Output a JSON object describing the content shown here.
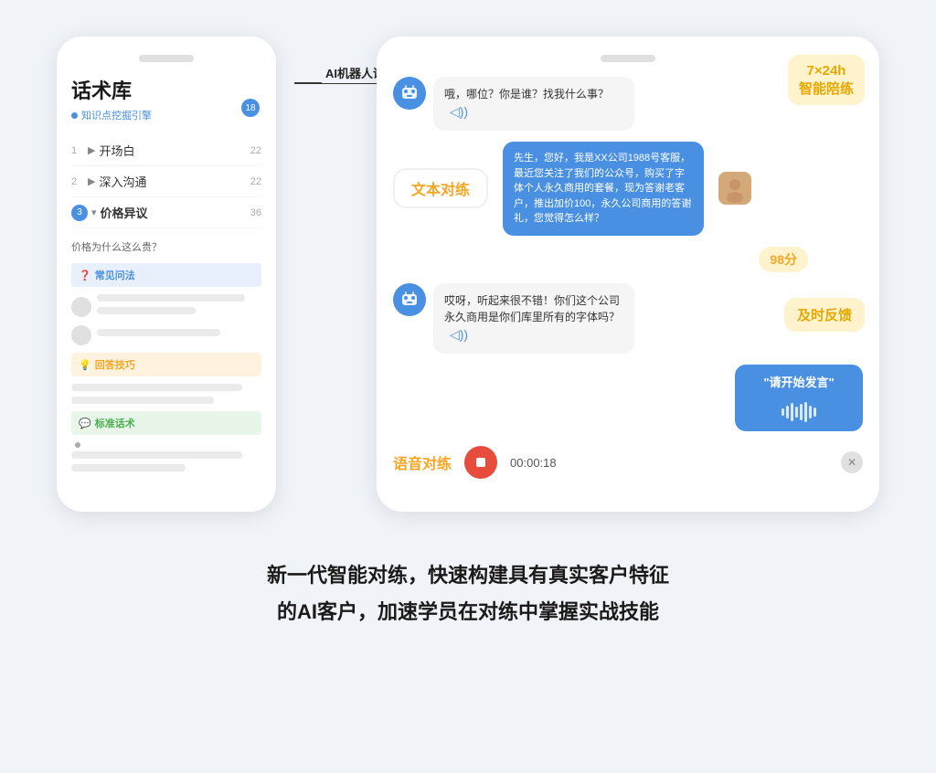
{
  "left_phone": {
    "notch": "",
    "title": "话术库",
    "subtitle": "知识点挖掘引擎",
    "badge": "18",
    "menu": [
      {
        "num": "1",
        "label": "开场白",
        "count": "22",
        "active": false
      },
      {
        "num": "2",
        "label": "深入沟通",
        "count": "22",
        "active": false
      },
      {
        "num": "3",
        "label": "价格异议",
        "count": "36",
        "active": true
      }
    ],
    "question": "价格为什么这么贵？",
    "sections": [
      {
        "type": "blue",
        "icon": "❓",
        "label": "常见问法"
      },
      {
        "type": "orange",
        "icon": "💡",
        "label": "回答技巧"
      },
      {
        "type": "green",
        "icon": "💬",
        "label": "标准话术"
      }
    ]
  },
  "connector": {
    "label": "AI机器人话术对练"
  },
  "right_phone": {
    "title": "AI机器人话术对练",
    "chat": [
      {
        "side": "left",
        "type": "robot",
        "text": "哦，哪位？你是谁？找我什么事？",
        "has_sound": true
      },
      {
        "side": "right",
        "type": "human",
        "text": "先生，您好，我是XX公司1988号客服，最近您关注了我们的公众号，购买了字体个人永久商用的套餐，现为答谢老客户，推出加价100，永久公司商用的答谢礼，您觉得怎么样？"
      },
      {
        "side": "left",
        "type": "robot",
        "text": "哎呀，听起来很不错！你们这个公司永久商用是你们库里所有的字体吗？",
        "has_sound": true
      },
      {
        "side": "right",
        "type": "voice",
        "text": "\"请开始发言\""
      }
    ],
    "score": "98分",
    "float_247": "7×24h\n智能陪练",
    "float_feedback": "及时反馈",
    "text_practice": "文本对练",
    "voice_practice": "语音对练",
    "timer": "00:00:18"
  },
  "bottom_text": {
    "line1": "新一代智能对练，快速构建具有真实客户特征",
    "line2": "的AI客户，加速学员在对练中掌握实战技能"
  }
}
